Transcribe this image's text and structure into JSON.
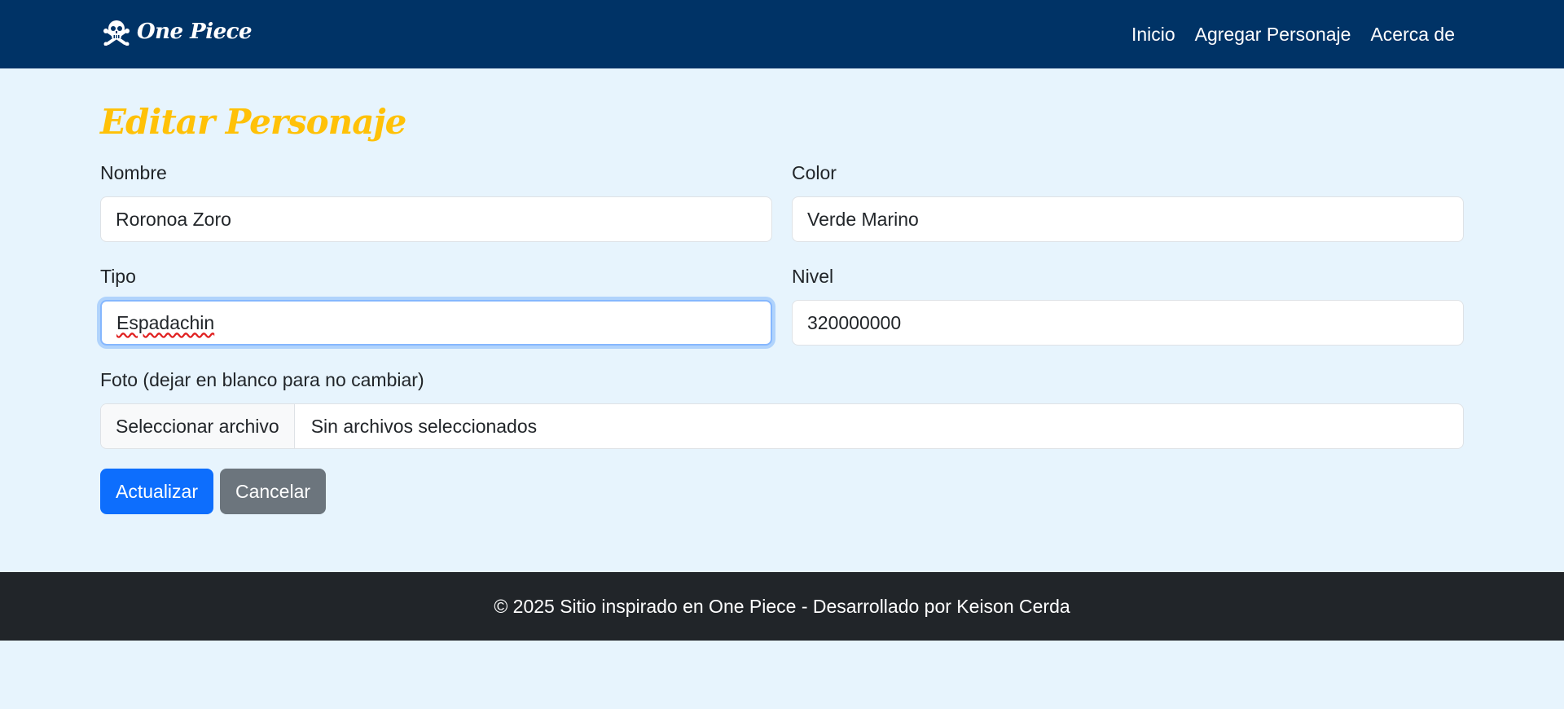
{
  "navbar": {
    "brand": "One Piece",
    "brand_icon": "skull-crossbones-icon",
    "links": [
      "Inicio",
      "Agregar Personaje",
      "Acerca de"
    ],
    "background": "#003366"
  },
  "page": {
    "title": "Editar Personaje",
    "title_color": "#ffc107"
  },
  "form": {
    "nombre": {
      "label": "Nombre",
      "value": "Roronoa Zoro"
    },
    "color": {
      "label": "Color",
      "value": "Verde Marino"
    },
    "tipo": {
      "label": "Tipo",
      "value": "Espadachin"
    },
    "nivel": {
      "label": "Nivel",
      "value": "320000000"
    },
    "foto": {
      "label": "Foto (dejar en blanco para no cambiar)",
      "button": "Seleccionar archivo",
      "status": "Sin archivos seleccionados"
    },
    "submit_label": "Actualizar",
    "cancel_label": "Cancelar"
  },
  "footer": {
    "text": "© 2025 Sitio inspirado en One Piece - Desarrollado por Keison Cerda"
  }
}
